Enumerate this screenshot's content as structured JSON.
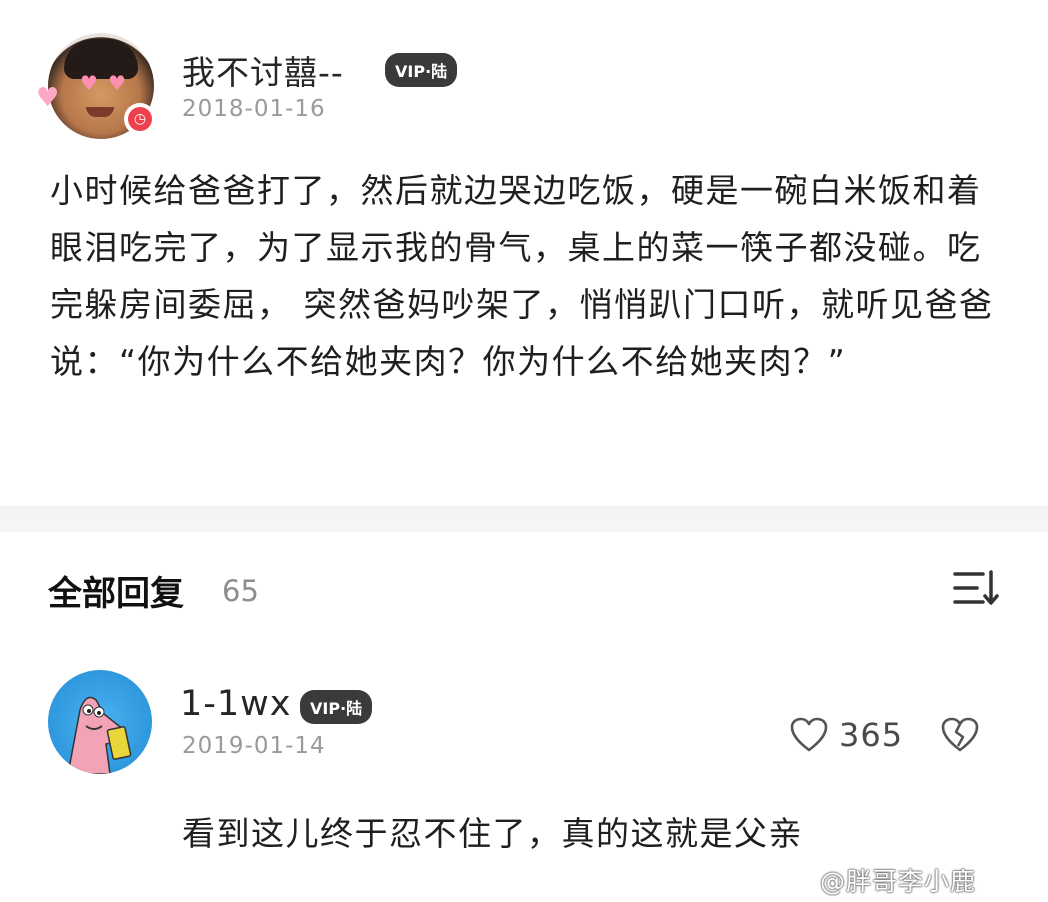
{
  "post": {
    "username": "我不讨囍--",
    "vip_badge": "VIP·陆",
    "date": "2018-01-16",
    "body": "小时候给爸爸打了，然后就边哭边吃饭，硬是一碗白米饭和着眼泪吃完了，为了显示我的骨气，桌上的菜一筷子都没碰。吃完躲房间委屈， 突然爸妈吵架了，悄悄趴门口听，就听见爸爸说：“你为什么不给她夹肉？你为什么不给她夹肉？”"
  },
  "replies": {
    "title": "全部回复",
    "count": "65",
    "sort_icon": "sort-icon"
  },
  "comment": {
    "username": "1-1wx",
    "vip_badge": "VIP·陆",
    "date": "2019-01-14",
    "like_count": "365",
    "text": "看到这儿终于忍不住了，真的这就是父亲"
  },
  "watermark": {
    "text": "@胖哥李小鹿"
  },
  "colors": {
    "badge_bg": "#3a3a3a",
    "verify_red": "#ee3f4d",
    "date_gray": "#9a9a9a",
    "comment_avatar_blue": "#2f98de"
  }
}
